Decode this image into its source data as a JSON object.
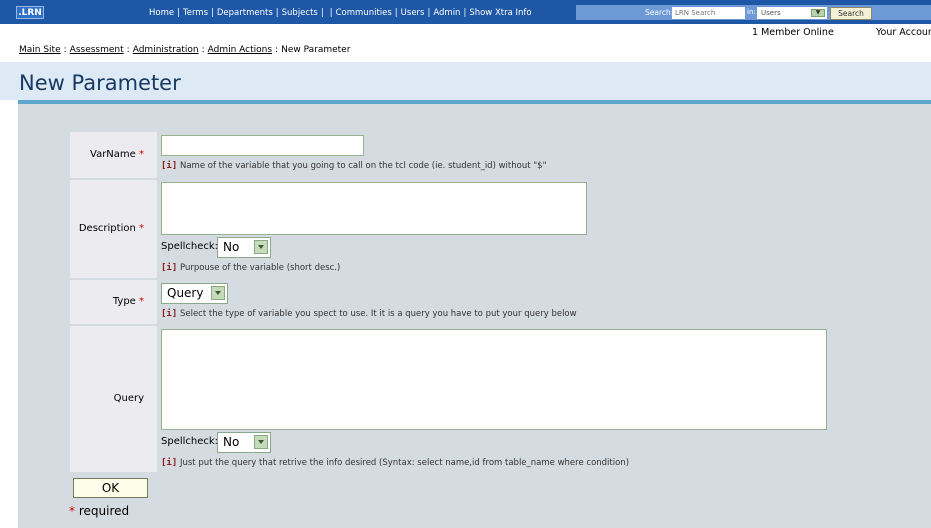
{
  "topbar": {
    "logo": ".LRN",
    "nav": [
      "Home",
      "Terms",
      "Departments",
      "Subjects",
      "",
      "Communities",
      "Users",
      "Admin",
      "Show Xtra Info"
    ],
    "search_label": "Search:",
    "search_placeholder": "LRN Search",
    "in_label": "in:",
    "search_scope": "Users",
    "search_button": "Search"
  },
  "status": {
    "members_online": "1 Member Online",
    "account": "Your Account"
  },
  "breadcrumb": {
    "items": [
      "Main Site",
      "Assessment",
      "Administration",
      "Admin Actions"
    ],
    "current": "New Parameter"
  },
  "page_title": "New Parameter",
  "form": {
    "varname": {
      "label": "VarName",
      "value": "",
      "help": "Name of the variable that you going to call on the tcl code (ie. student_id) without \"$\""
    },
    "description": {
      "label": "Description",
      "value": "",
      "spellcheck_label": "Spellcheck:",
      "spellcheck_value": "No",
      "help": "Purpouse of the variable (short desc.)"
    },
    "type": {
      "label": "Type",
      "value": "Query",
      "help": "Select the type of variable you spect to use. It it is a query you have to put your query below"
    },
    "query": {
      "label": "Query",
      "value": "",
      "spellcheck_label": "Spellcheck:",
      "spellcheck_value": "No",
      "help": "Just put the query that retrive the info desired (Syntax: select name,id from table_name where condition)"
    },
    "required_marker": "*",
    "info_marker": "[i]",
    "ok_button": "OK",
    "required_note": "required"
  },
  "colors": {
    "topbar": "#1d57a6",
    "title": "#173b62",
    "form_bg": "#d4dbe1",
    "label_bg": "#ecebef",
    "required": "#d00000"
  }
}
